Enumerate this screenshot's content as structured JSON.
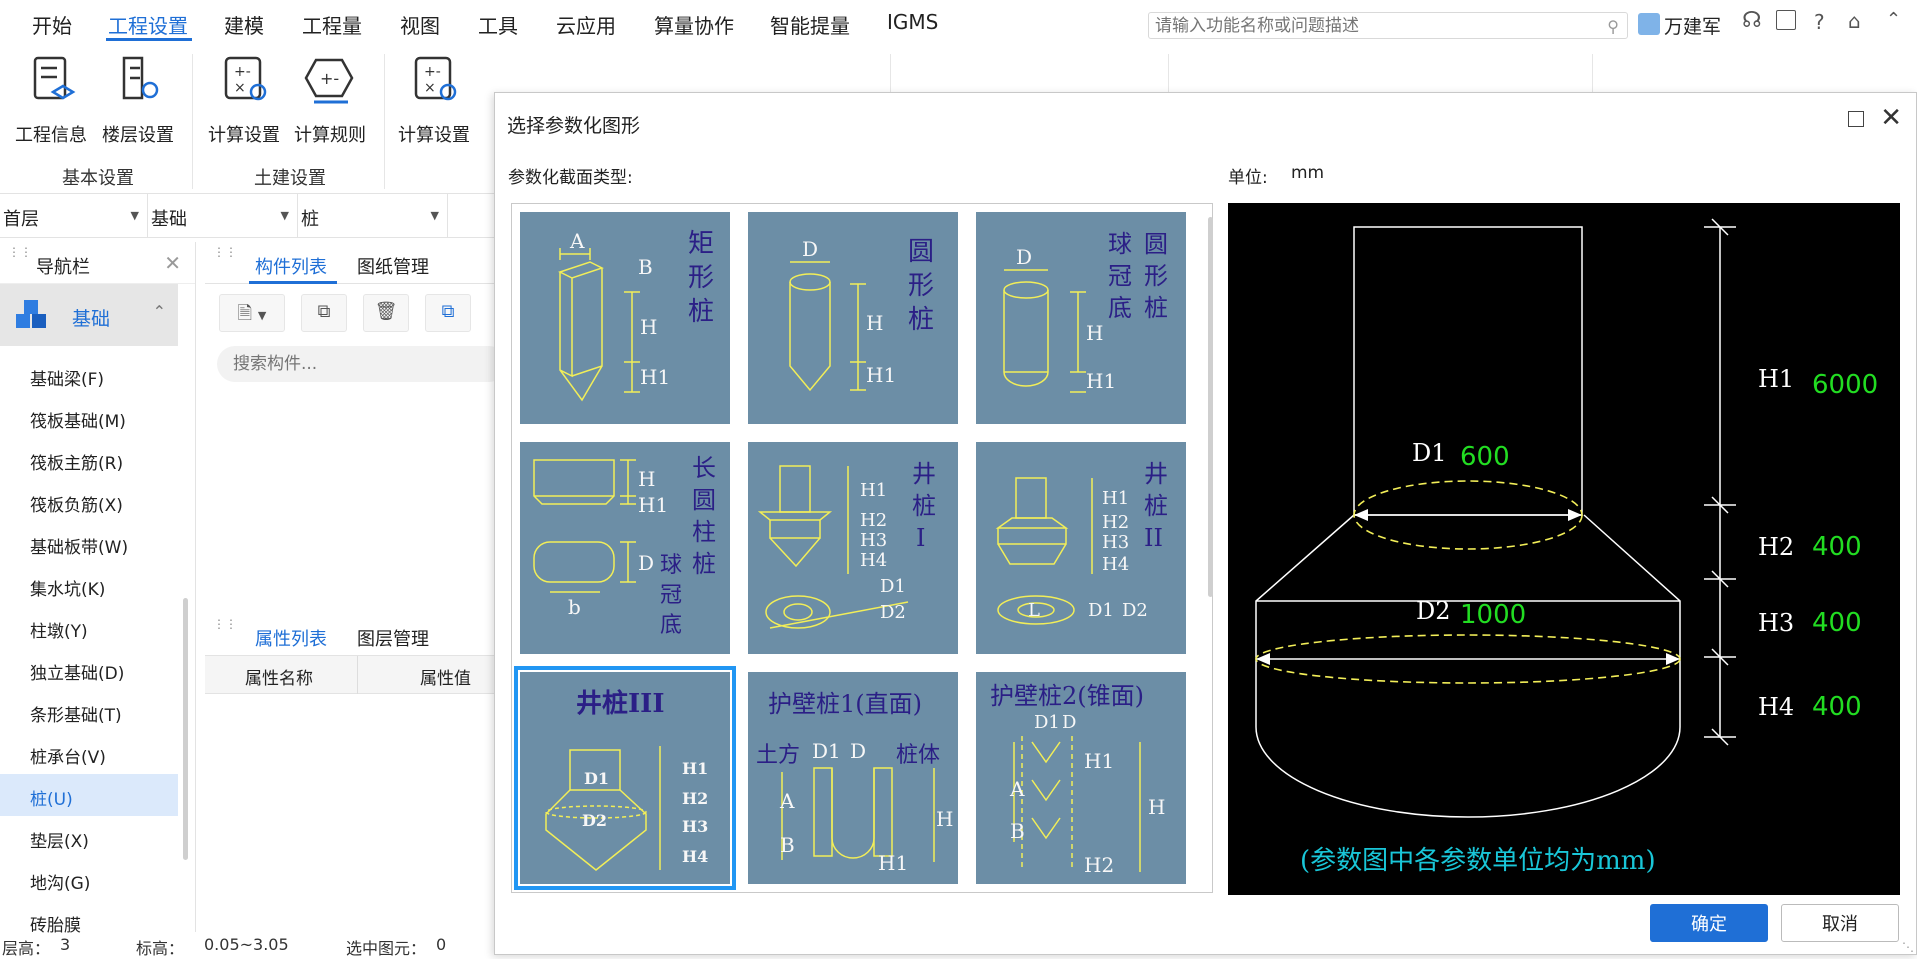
{
  "menubar": {
    "items": [
      "开始",
      "工程设置",
      "建模",
      "工程量",
      "视图",
      "工具",
      "云应用",
      "算量协作",
      "智能提量",
      "IGMS"
    ],
    "active_index": 1,
    "search_placeholder": "请输入功能名称或问题描述",
    "user_name": "万建军",
    "help_label": "?"
  },
  "ribbon": {
    "buttons": [
      "工程信息",
      "楼层设置",
      "计算设置",
      "计算规则",
      "计算设置"
    ],
    "groups": [
      "基本设置",
      "土建设置"
    ]
  },
  "floorbar": {
    "floor": "首层",
    "category": "基础",
    "type": "桩"
  },
  "nav": {
    "title": "导航栏",
    "category": "基础",
    "items": [
      "基础梁(F)",
      "筏板基础(M)",
      "筏板主筋(R)",
      "筏板负筋(X)",
      "基础板带(W)",
      "集水坑(K)",
      "柱墩(Y)",
      "独立基础(D)",
      "条形基础(T)",
      "桩承台(V)",
      "桩(U)",
      "垫层(X)",
      "地沟(G)",
      "砖胎膜"
    ],
    "selected_index": 10
  },
  "component_panel": {
    "tabs": [
      "构件列表",
      "图纸管理"
    ],
    "search_placeholder": "搜索构件..."
  },
  "property_panel": {
    "tabs": [
      "属性列表",
      "图层管理"
    ],
    "columns": [
      "属性名称",
      "属性值"
    ]
  },
  "statusbar": {
    "floor_label": "层高：",
    "floor_value": "3",
    "elev_label": "标高：",
    "elev_value": "0.05~3.05",
    "sel_label": "选中图元：",
    "sel_value": "0"
  },
  "dialog": {
    "title": "选择参数化图形",
    "section_label": "参数化截面类型:",
    "unit_label": "单位:",
    "unit_value": "mm",
    "ok_label": "确定",
    "cancel_label": "取消",
    "selected_shape": 6,
    "shapes": [
      {
        "name": "矩形桩",
        "params": [
          "A",
          "B",
          "H",
          "H1"
        ]
      },
      {
        "name": "圆形桩",
        "params": [
          "D",
          "H",
          "H1"
        ]
      },
      {
        "name": "圆形桩(球冠底)",
        "params": [
          "D",
          "H",
          "H1"
        ]
      },
      {
        "name": "长圆柱桩(球冠底)",
        "params": [
          "H",
          "H1",
          "D",
          "b"
        ]
      },
      {
        "name": "井桩I",
        "params": [
          "H1",
          "H2",
          "H3",
          "H4",
          "D1",
          "D2"
        ]
      },
      {
        "name": "井桩II",
        "params": [
          "H1",
          "H2",
          "H3",
          "H4",
          "L",
          "D1",
          "D2"
        ]
      },
      {
        "name": "井桩III",
        "params": [
          "D1",
          "D2",
          "H1",
          "H2",
          "H3",
          "H4"
        ]
      },
      {
        "name": "护壁桩1(直面)",
        "params": [
          "土方",
          "D1",
          "D",
          "桩体",
          "A",
          "B",
          "H",
          "H1"
        ]
      },
      {
        "name": "护壁桩2(锥面)",
        "params": [
          "D1",
          "D",
          "A",
          "B",
          "H1",
          "H",
          "H2"
        ]
      }
    ],
    "preview": {
      "note": "(参数图中各参数单位均为mm)",
      "params": [
        {
          "name": "H1",
          "value": "6000"
        },
        {
          "name": "D1",
          "value": "600"
        },
        {
          "name": "H2",
          "value": "400"
        },
        {
          "name": "D2",
          "value": "1000"
        },
        {
          "name": "H3",
          "value": "400"
        },
        {
          "name": "H4",
          "value": "400"
        }
      ]
    }
  },
  "colors": {
    "accent": "#1f6fd6",
    "tile_bg": "#6c8ea6",
    "preview_bg": "#000000",
    "param_value": "#22dd22",
    "note": "#19c6d8",
    "tile_text": "#2b1f86",
    "tile_line": "#f2ee58"
  }
}
